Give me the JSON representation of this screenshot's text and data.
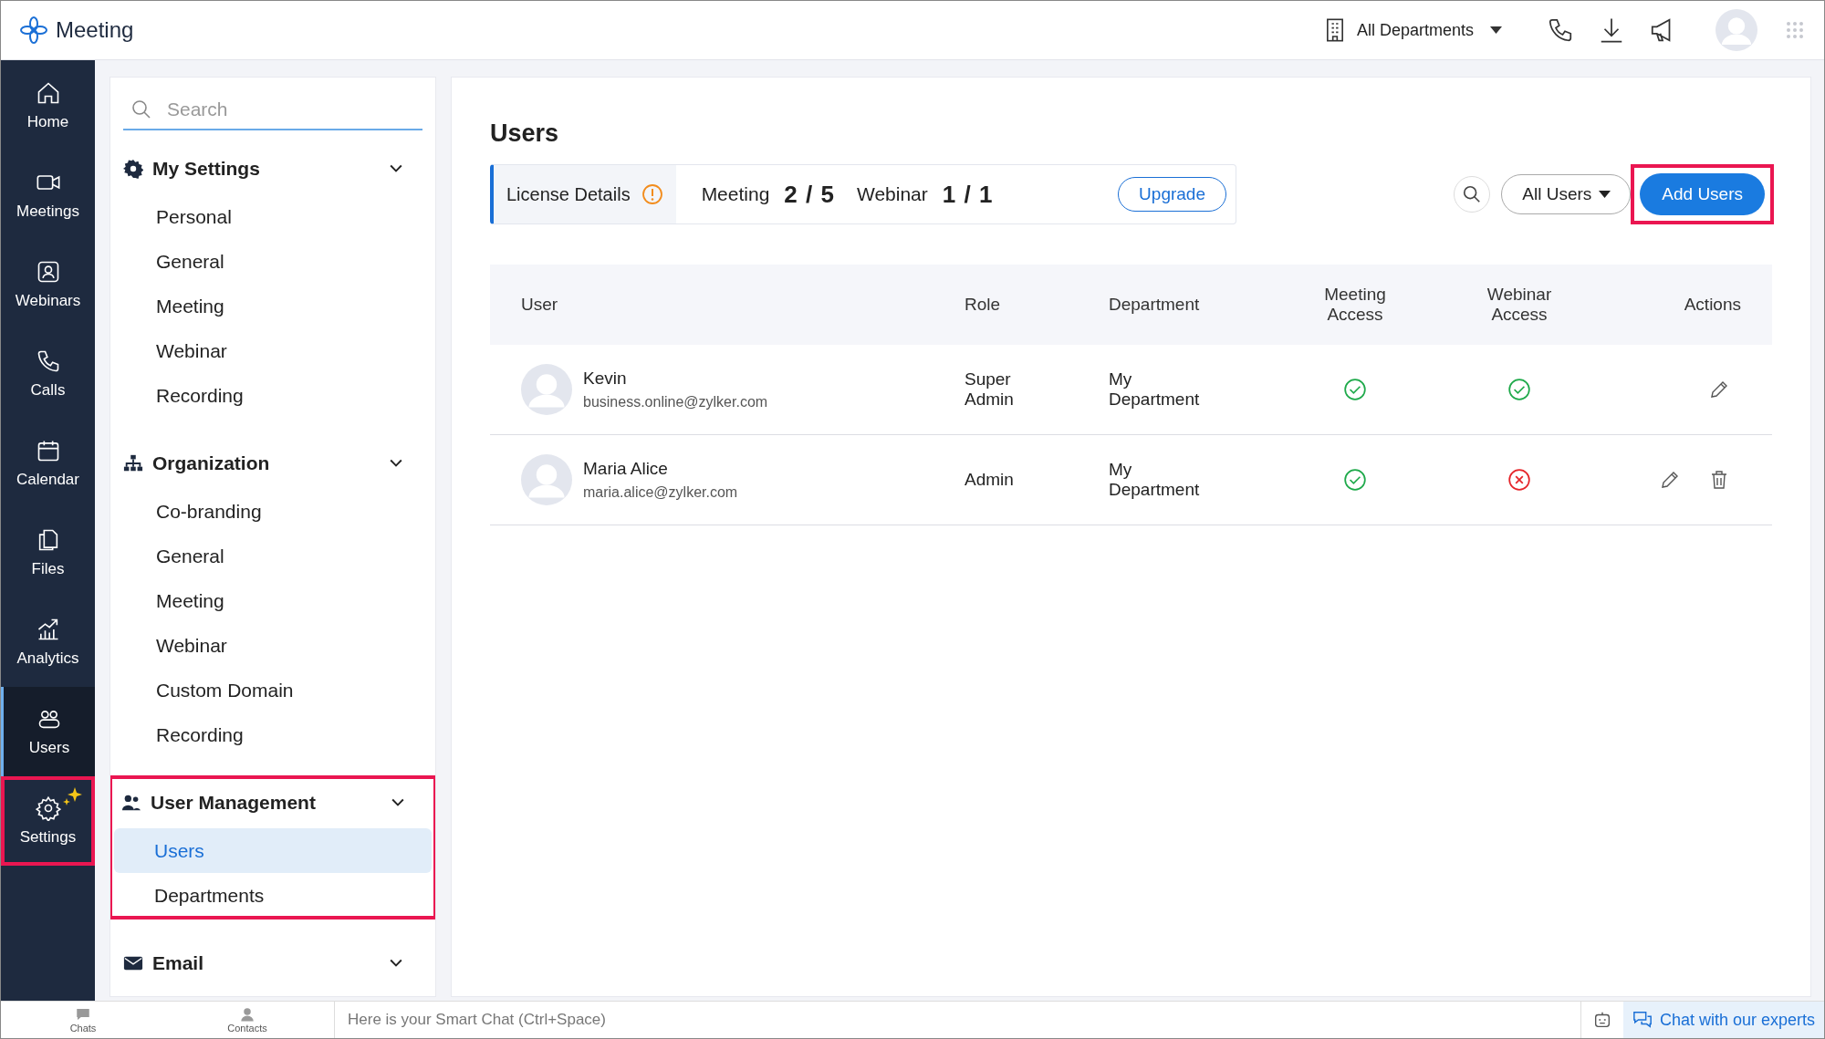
{
  "header": {
    "app_name": "Meeting",
    "department": "All Departments"
  },
  "nav": [
    {
      "label": "Home",
      "selected": false,
      "highlighted": false
    },
    {
      "label": "Meetings",
      "selected": false,
      "highlighted": false
    },
    {
      "label": "Webinars",
      "selected": false,
      "highlighted": false
    },
    {
      "label": "Calls",
      "selected": false,
      "highlighted": false
    },
    {
      "label": "Calendar",
      "selected": false,
      "highlighted": false
    },
    {
      "label": "Files",
      "selected": false,
      "highlighted": false
    },
    {
      "label": "Analytics",
      "selected": false,
      "highlighted": false
    },
    {
      "label": "Users",
      "selected": true,
      "highlighted": false
    },
    {
      "label": "Settings",
      "selected": false,
      "highlighted": true
    }
  ],
  "settings_search": {
    "placeholder": "Search"
  },
  "sections": [
    {
      "title": "My Settings",
      "highlighted": false,
      "items": [
        {
          "label": "Personal",
          "selected": false
        },
        {
          "label": "General",
          "selected": false
        },
        {
          "label": "Meeting",
          "selected": false
        },
        {
          "label": "Webinar",
          "selected": false
        },
        {
          "label": "Recording",
          "selected": false
        }
      ]
    },
    {
      "title": "Organization",
      "highlighted": false,
      "items": [
        {
          "label": "Co-branding",
          "selected": false
        },
        {
          "label": "General",
          "selected": false
        },
        {
          "label": "Meeting",
          "selected": false
        },
        {
          "label": "Webinar",
          "selected": false
        },
        {
          "label": "Custom Domain",
          "selected": false
        },
        {
          "label": "Recording",
          "selected": false
        }
      ]
    },
    {
      "title": "User Management",
      "highlighted": true,
      "items": [
        {
          "label": "Users",
          "selected": true
        },
        {
          "label": "Departments",
          "selected": false
        }
      ]
    },
    {
      "title": "Email",
      "highlighted": false
    }
  ],
  "main": {
    "title": "Users",
    "license": {
      "label": "License Details",
      "meeting_label": "Meeting",
      "meeting_count": "2 / 5",
      "webinar_label": "Webinar",
      "webinar_count": "1 / 1",
      "upgrade": "Upgrade"
    },
    "filter": "All Users",
    "add_button": {
      "label": "Add Users",
      "highlighted": true
    }
  },
  "table": {
    "columns": [
      "User",
      "Role",
      "Department",
      "Meeting Access",
      "Webinar Access",
      "Actions"
    ],
    "rows": [
      {
        "name": "Kevin",
        "email": "business.online@zylker.com",
        "role": "Super Admin",
        "department": "My Department",
        "meeting_access": true,
        "webinar_access": true,
        "deletable": false
      },
      {
        "name": "Maria Alice",
        "email": "maria.alice@zylker.com",
        "role": "Admin",
        "department": "My Department",
        "meeting_access": true,
        "webinar_access": false,
        "deletable": true
      }
    ]
  },
  "bottom_bar": {
    "chats": "Chats",
    "contacts": "Contacts",
    "chat_placeholder": "Here is your Smart Chat (Ctrl+Space)",
    "experts": "Chat with our experts"
  }
}
